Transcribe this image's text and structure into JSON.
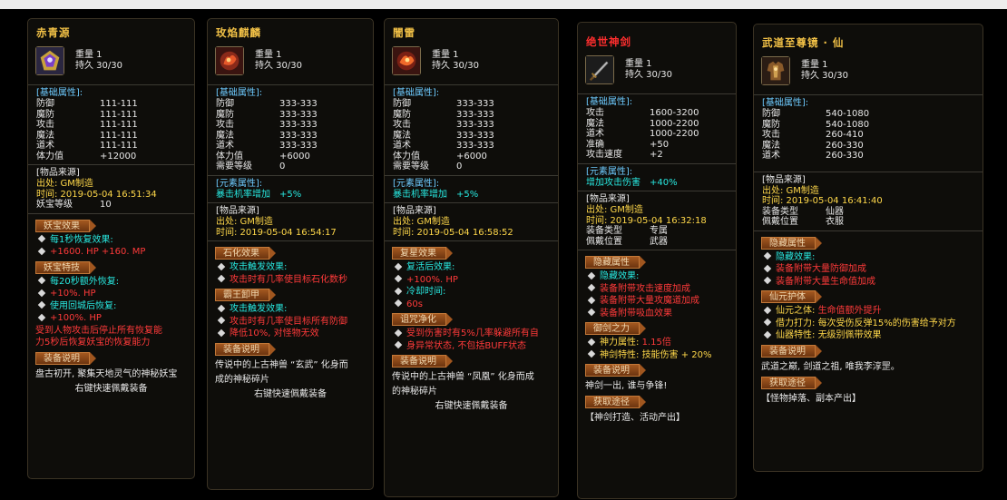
{
  "cards": [
    {
      "title": "赤青源",
      "head": [
        "重量 1",
        "持久 30/30"
      ],
      "base_title": "[基础属性]:",
      "base": [
        [
          "防御",
          "111-111"
        ],
        [
          "魔防",
          "111-111"
        ],
        [
          "攻击",
          "111-111"
        ],
        [
          "魔法",
          "111-111"
        ],
        [
          "道术",
          "111-111"
        ],
        [
          "体力值",
          "+12000"
        ]
      ],
      "source_title": "[物品来源]",
      "src_line1": "出处: GM制造",
      "src_line2": "时间: 2019-05-04 16:51:34",
      "yao_k": "妖宝等级",
      "yao_v": "10",
      "tag1": "妖宝效果",
      "f1": "每1秒恢复效果:",
      "f2": "+1600. HP   +160. MP",
      "tag2": "妖宝特技",
      "f3": "每20秒额外恢复:",
      "f4": "+10%. HP",
      "f5": "使用回城后恢复:",
      "f6": "+100%. HP",
      "red1": "受到人物攻击后停止所有恢复能",
      "red2": "力5秒后恢复妖宝的恢复能力",
      "tag3": "装备说明",
      "desc1": "盘古初开, 聚集天地灵气的神秘妖宝",
      "green": "右键快速佩戴装备"
    },
    {
      "title": "玫焰麒麟",
      "head": [
        "重量 1",
        "持久 30/30"
      ],
      "base_title": "[基础属性]:",
      "base": [
        [
          "防御",
          "333-333"
        ],
        [
          "魔防",
          "333-333"
        ],
        [
          "攻击",
          "333-333"
        ],
        [
          "魔法",
          "333-333"
        ],
        [
          "道术",
          "333-333"
        ],
        [
          "体力值",
          "+6000"
        ],
        [
          "需要等级",
          "0"
        ]
      ],
      "elem_title": "[元素属性]:",
      "elem_k": "暴击机率增加",
      "elem_v": "+5%",
      "source_title": "[物品来源]",
      "src_line1": "出处: GM制造",
      "src_line2": "时间: 2019-05-04 16:54:17",
      "tag1": "石化效果",
      "f1": "攻击触发效果:",
      "f2": "攻击时有几率使目标石化数秒",
      "tag2": "霸王卸甲",
      "f3": "攻击触发效果:",
      "f4": "攻击时有几率使目标所有防御",
      "f5": "降低10%, 对怪物无效",
      "tag3": "装备说明",
      "desc1": "传说中的上古神兽 “玄武” 化身而",
      "desc2": "成的神秘碎片",
      "green": "右键快速佩戴装备"
    },
    {
      "title": "闇雷",
      "head": [
        "重量 1",
        "持久 30/30"
      ],
      "base_title": "[基础属性]:",
      "base": [
        [
          "防御",
          "333-333"
        ],
        [
          "魔防",
          "333-333"
        ],
        [
          "攻击",
          "333-333"
        ],
        [
          "魔法",
          "333-333"
        ],
        [
          "道术",
          "333-333"
        ],
        [
          "体力值",
          "+6000"
        ],
        [
          "需要等级",
          "0"
        ]
      ],
      "elem_title": "[元素属性]:",
      "elem_k": "暴击机率增加",
      "elem_v": "+5%",
      "source_title": "[物品来源]",
      "src_line1": "出处: GM制造",
      "src_line2": "时间: 2019-05-04 16:58:52",
      "tag1": "复星效果",
      "f1": "复活后效果:",
      "f2": "+100%. HP",
      "f3": "冷却时间:",
      "f4": "60s",
      "tag2": "诅咒净化",
      "f5": "受到伤害时有5%几率躲避所有自",
      "f6": "身异常状态, 不包括BUFF状态",
      "tag3": "装备说明",
      "desc1": "传说中的上古神兽 “凤凰” 化身而成",
      "desc2": "的神秘碎片",
      "green": "右键快速佩戴装备"
    },
    {
      "title": "绝世神剑",
      "head": [
        "重量 1",
        "持久 30/30"
      ],
      "base_title": "[基础属性]:",
      "base": [
        [
          "攻击",
          "1600-3200"
        ],
        [
          "魔法",
          "1000-2200"
        ],
        [
          "道术",
          "1000-2200"
        ],
        [
          "准确",
          "+50"
        ],
        [
          "攻击速度",
          "+2"
        ]
      ],
      "elem_title": "[元素属性]:",
      "elem_k": "增加攻击伤害",
      "elem_v": "+40%",
      "source_title": "[物品来源]",
      "src_line1": "出处: GM制造",
      "src_line2": "时间: 2019-05-04 16:32:18",
      "kv": [
        [
          "装备类型",
          "专属"
        ],
        [
          "佩戴位置",
          "武器"
        ]
      ],
      "tag1": "隐藏属性",
      "f1": "隐藏效果:",
      "f2": "装备附带攻击速度加成",
      "f3": "装备附带大量攻魔道加成",
      "f4": "装备附带吸血效果",
      "tag2": "御剑之力",
      "f5k": "神力属性: ",
      "f5v": "1.15倍",
      "f6k": "神剑特性: ",
      "f6v": "技能伤害 + 20%",
      "tag3": "装备说明",
      "desc1": "神剑一出, 谁与争锋!",
      "tag4": "获取途径",
      "blue": "【神剑打造、活动产出】"
    },
    {
      "title": "武道至尊镜 · 仙",
      "head": [
        "重量 1",
        "持久 30/30"
      ],
      "base_title": "[基础属性]:",
      "base": [
        [
          "防御",
          "540-1080"
        ],
        [
          "魔防",
          "540-1080"
        ],
        [
          "攻击",
          "260-410"
        ],
        [
          "魔法",
          "260-330"
        ],
        [
          "道术",
          "260-330"
        ]
      ],
      "source_title": "[物品来源]",
      "src_line1": "出处: GM制造",
      "src_line2": "时间: 2019-05-04 16:41:40",
      "kv": [
        [
          "装备类型",
          "仙器"
        ],
        [
          "佩戴位置",
          "衣服"
        ]
      ],
      "tag1": "隐藏属性",
      "f1": "隐藏效果:",
      "f2": "装备附带大量防御加成",
      "f3": "装备附带大量生命值加成",
      "tag2": "仙元护体",
      "f4k": "仙元之体: ",
      "f4v": "生命值额外提升",
      "f5k": "借力打力: ",
      "f5v": "每次受伤反弹15%的伤害给予对方",
      "f6k": "仙器特性: ",
      "f6v": "无级别佩带效果",
      "tag3": "装备说明",
      "desc1": "武道之巅, 剑道之祖, 唯我李淳罡。",
      "tag4": "获取途径",
      "blue": "【怪物掉落、副本产出】"
    }
  ]
}
